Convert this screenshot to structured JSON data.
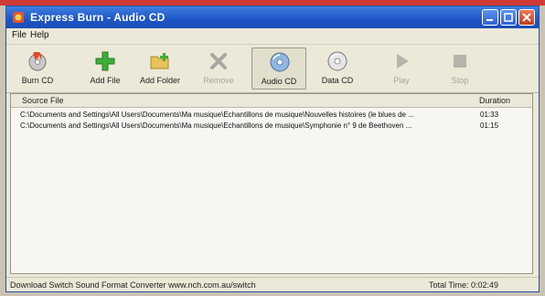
{
  "window": {
    "title": "Express Burn - Audio CD"
  },
  "menu": [
    "File",
    "Help"
  ],
  "toolbar": {
    "burn_cd": "Burn CD",
    "add_file": "Add File",
    "add_folder": "Add Folder",
    "remove": "Remove",
    "audio_cd": "Audio CD",
    "data_cd": "Data CD",
    "play": "Play",
    "stop": "Stop"
  },
  "list": {
    "columns": {
      "source": "Source File",
      "duration": "Duration"
    },
    "rows": [
      {
        "path": "C:\\Documents and Settings\\All Users\\Documents\\Ma musique\\Echantillons de musique\\Nouvelles histoires (le blues de ...",
        "duration": "01:33"
      },
      {
        "path": "C:\\Documents and Settings\\All Users\\Documents\\Ma musique\\Echantillons de musique\\Symphonie n° 9 de Beethoven ...",
        "duration": "01:15"
      }
    ]
  },
  "status": {
    "message": "Download Switch Sound Format Converter www.nch.com.au/switch",
    "total_time": "Total Time: 0:02:49"
  },
  "colors": {
    "titlebar": "#1d55c7",
    "window_bg": "#ece9d8",
    "list_bg": "#f7f6f2"
  }
}
